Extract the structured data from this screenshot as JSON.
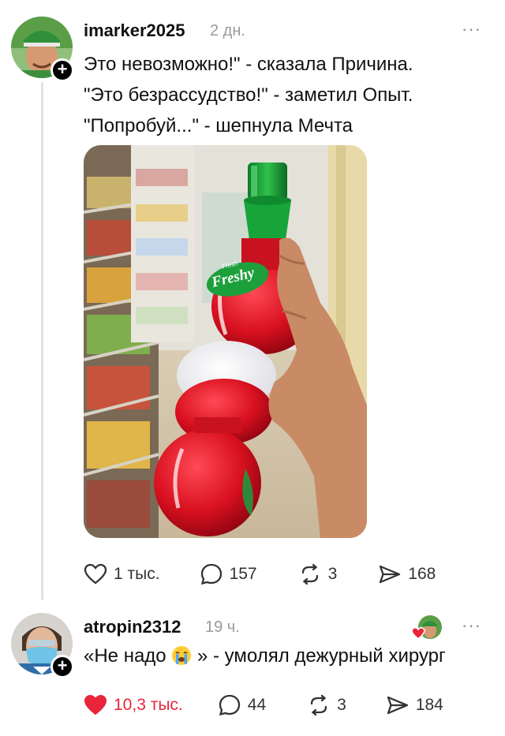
{
  "post": {
    "username": "imarker2025",
    "time": "2 дн.",
    "more": "···",
    "follow": "+",
    "text_lines": [
      "Это невозможно!\" - сказала Причина.",
      "\"Это безрассудство!\" - заметил Опыт.",
      "\"Попробуй...\" - шепнула Мечта"
    ],
    "image": {
      "brand_small": "Fresh",
      "brand": "Freshy"
    },
    "actions": {
      "likes": "1 тыс.",
      "comments": "157",
      "reposts": "3",
      "shares": "168"
    }
  },
  "reply": {
    "username": "atropin2312",
    "time": "19 ч.",
    "more": "···",
    "follow": "+",
    "text_before": "«Не надо",
    "text_after": "» - умолял дежурный хирург",
    "actions": {
      "likes": "10,3 тыс.",
      "comments": "44",
      "reposts": "3",
      "shares": "184"
    }
  },
  "colors": {
    "like_red": "#e8253b",
    "text": "#111111",
    "muted": "#9a9a9a"
  }
}
